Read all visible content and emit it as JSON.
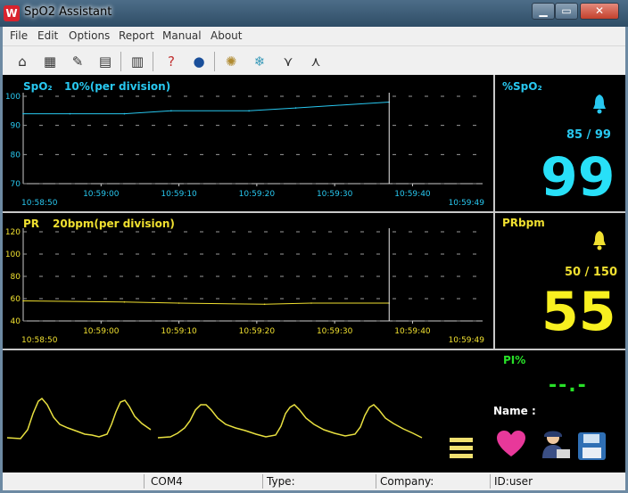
{
  "window": {
    "title": "SpO2 Assistant",
    "icon": "app-logo",
    "min_label": "▁",
    "max_label": "▭",
    "close_label": "✕"
  },
  "menu": [
    "File",
    "Edit",
    "Options",
    "Report",
    "Manual",
    "About"
  ],
  "toolbar": [
    "home-icon",
    "device-icon",
    "open-folder-icon",
    "print-icon",
    "chart-icon",
    "help-icon",
    "globe-icon",
    "burst-icon",
    "snowflake-icon",
    "waveform-down-icon",
    "waveform-up-icon"
  ],
  "spo2": {
    "header_name": "SpO₂",
    "header_scale": "10%(per division)",
    "yticks": [
      "100",
      "90",
      "80",
      "70"
    ],
    "xticks": [
      "10:59:00",
      "10:59:10",
      "10:59:20",
      "10:59:30",
      "10:59:40"
    ],
    "start_time": "10:58:50",
    "end_time": "10:59:49",
    "panel_label": "%SpO₂",
    "limits": "85 / 99",
    "value": "99",
    "color": "#28c8f0"
  },
  "pr": {
    "header_name": "PR",
    "header_scale": "20bpm(per division)",
    "yticks": [
      "120",
      "100",
      "80",
      "60",
      "40"
    ],
    "xticks": [
      "10:59:00",
      "10:59:10",
      "10:59:20",
      "10:59:30",
      "10:59:40"
    ],
    "start_time": "10:58:50",
    "end_time": "10:59:49",
    "panel_label": "PRbpm",
    "limits": "50 / 150",
    "value": "55",
    "color": "#f0e030"
  },
  "pi": {
    "label": "PI%",
    "value": "--.-",
    "color": "#28e028"
  },
  "name_label": "Name :",
  "status": {
    "port": "COM4",
    "type": "Type:",
    "company": "Company:",
    "id": "ID:user"
  },
  "chart_data": [
    {
      "type": "line",
      "title": "SpO₂ 10%(per division)",
      "xlabel": "",
      "ylabel": "",
      "ylim": [
        70,
        100
      ],
      "x": [
        "10:58:50",
        "10:58:56",
        "10:59:03",
        "10:59:09",
        "10:59:19",
        "10:59:25",
        "10:59:37",
        "10:59:37"
      ],
      "series": [
        {
          "name": "",
          "values": [
            94,
            94,
            94,
            95,
            95,
            96,
            98,
            98
          ]
        }
      ]
    },
    {
      "type": "line",
      "title": "PR 20bpm(per division)",
      "xlabel": "",
      "ylabel": "",
      "ylim": [
        40,
        120
      ],
      "x": [
        "10:58:50",
        "10:59:03",
        "10:59:10",
        "10:59:21",
        "10:59:27",
        "10:59:37"
      ],
      "series": [
        {
          "name": "",
          "values": [
            58,
            57,
            56,
            55,
            56,
            56
          ]
        }
      ]
    }
  ]
}
